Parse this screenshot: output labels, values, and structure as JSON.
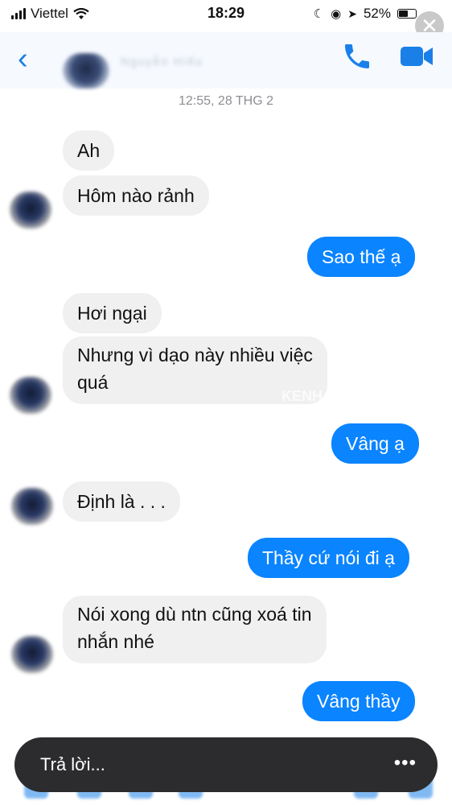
{
  "status_bar": {
    "carrier": "Viettel",
    "time": "18:29",
    "battery": "52%"
  },
  "header": {
    "contact_name": "Nguyễn Hiếu"
  },
  "conversation": {
    "timestamp": "12:55, 28 THG 2",
    "messages": [
      {
        "from": "them",
        "text": "Ah"
      },
      {
        "from": "them",
        "text": "Hôm nào rảnh"
      },
      {
        "from": "me",
        "text": "Sao thế ạ"
      },
      {
        "from": "them",
        "text": "Hơi ngại"
      },
      {
        "from": "them",
        "text": "Nhưng vì dạo này nhiều việc",
        "text2": "quá"
      },
      {
        "from": "me",
        "text": "Vâng ạ"
      },
      {
        "from": "them",
        "text": "Định là . . ."
      },
      {
        "from": "me",
        "text": "Thầy cứ nói đi ạ"
      },
      {
        "from": "them",
        "text": "Nói xong dù ntn cũng xoá tin",
        "text2": "nhắn nhé"
      },
      {
        "from": "me",
        "text": "Vâng thầy"
      }
    ]
  },
  "watermark": "KENH",
  "reply_bar": {
    "placeholder": "Trả lời...",
    "more": "•••"
  },
  "colors": {
    "accent": "#0a84ff",
    "incoming_bubble": "#f0f0f0",
    "reply_bar": "#2c2c2e"
  },
  "icons": [
    "back-icon",
    "phone-icon",
    "video-camera-icon",
    "more-icon",
    "close-icon"
  ]
}
